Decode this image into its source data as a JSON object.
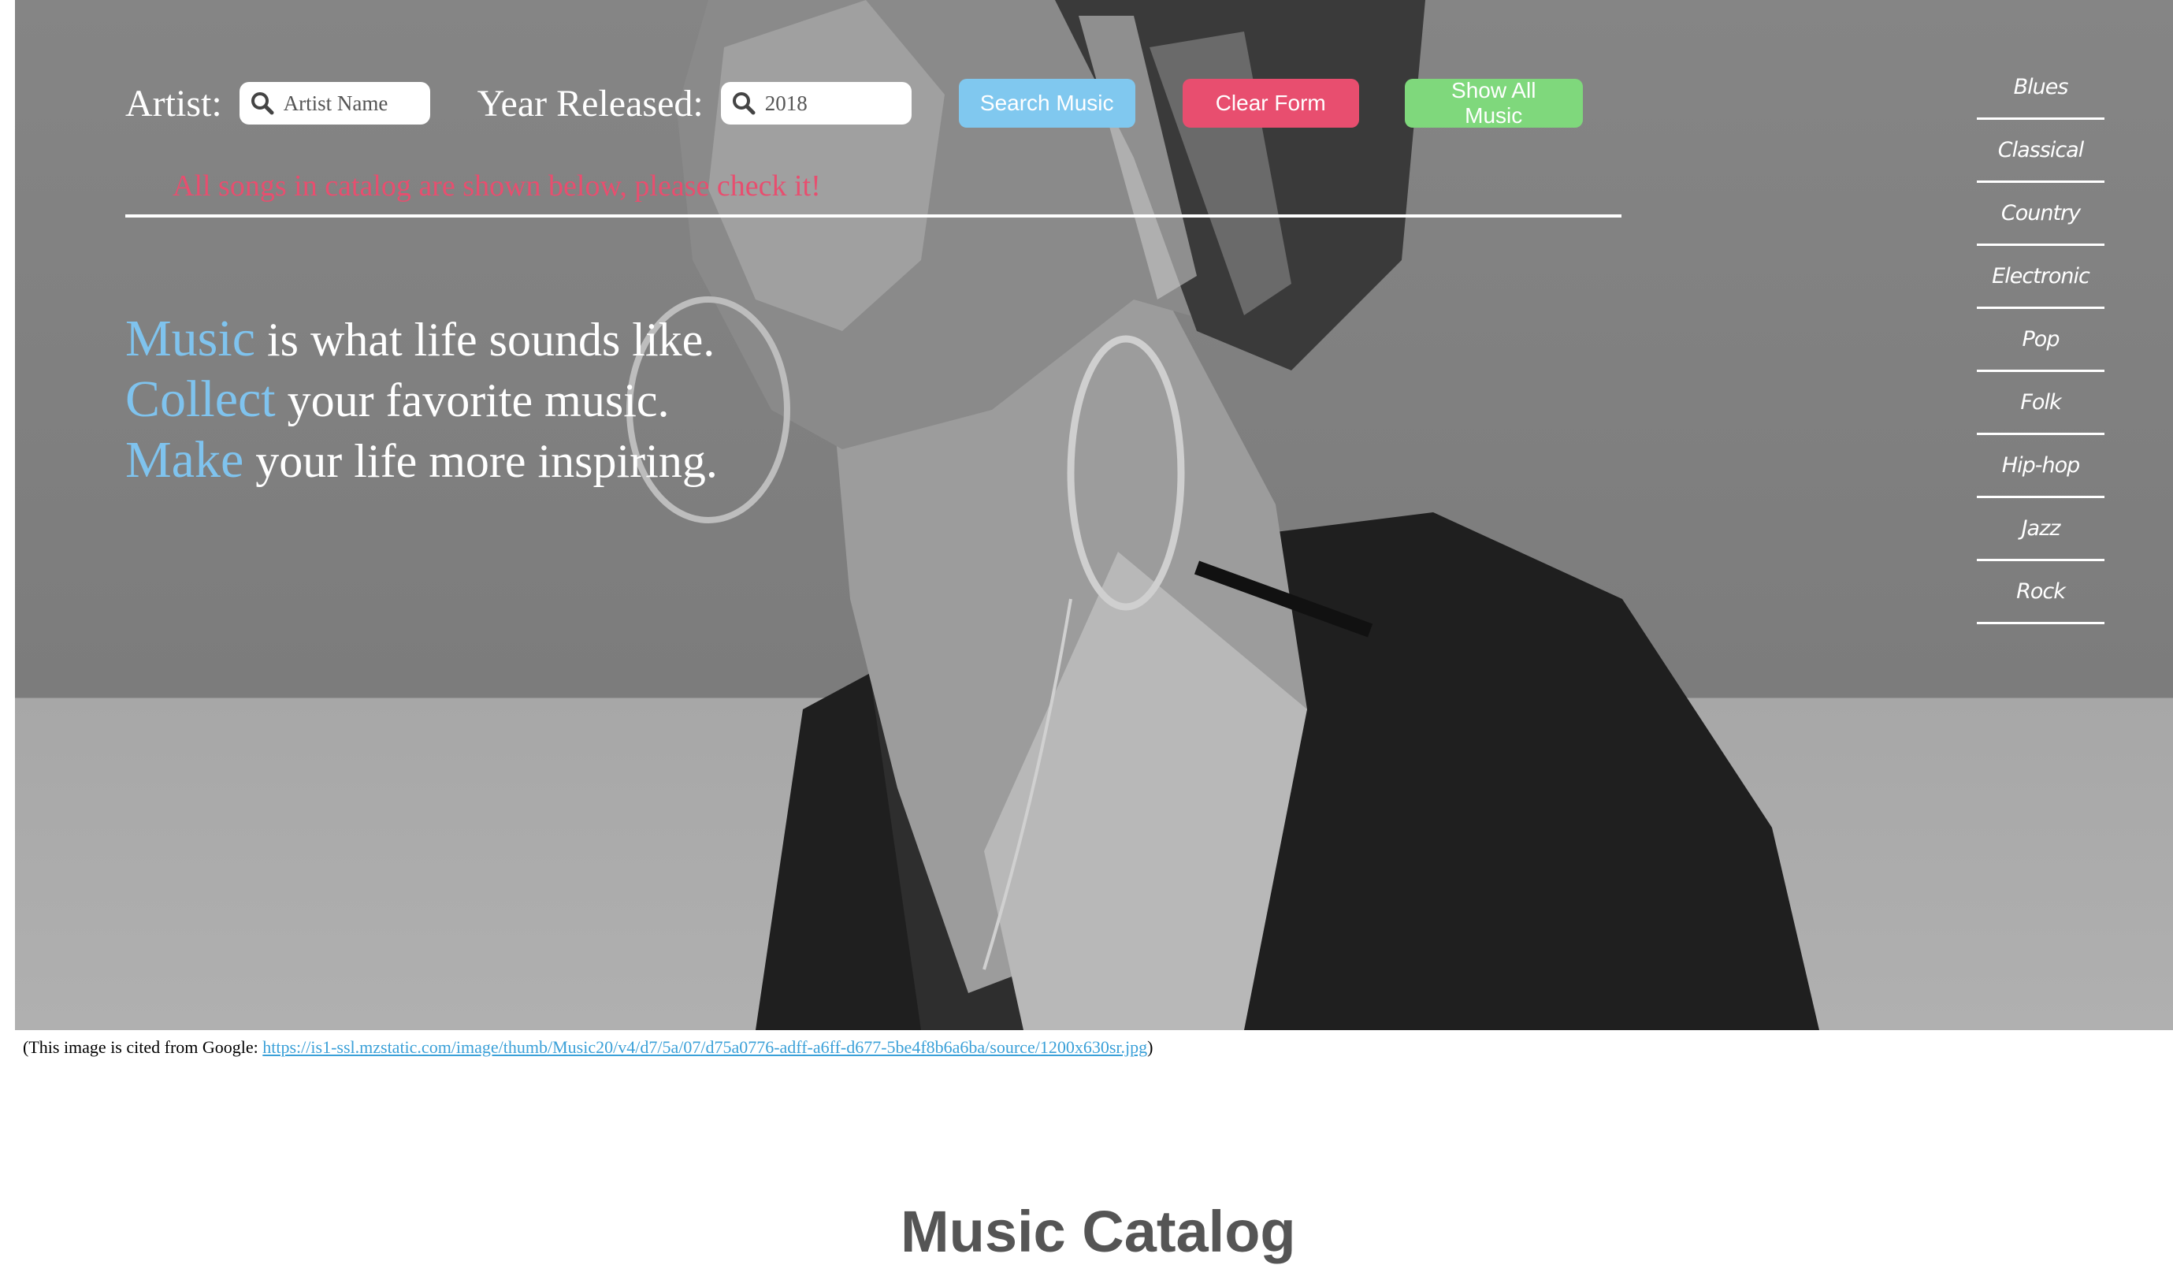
{
  "search": {
    "artist_label": "Artist:",
    "artist_placeholder": "Artist Name",
    "artist_value": "",
    "year_label": "Year Released:",
    "year_placeholder": "",
    "year_value": "2018",
    "search_button": "Search Music",
    "clear_button": "Clear Form",
    "show_all_button": "Show All Music"
  },
  "status_message": "All songs in catalog are shown below, please check it!",
  "slogan": [
    {
      "key": "Music",
      "rest": " is what life sounds like."
    },
    {
      "key": "Collect",
      "rest": " your favorite music."
    },
    {
      "key": "Make",
      "rest": " your life more inspiring."
    }
  ],
  "genres": [
    "Blues",
    "Classical",
    "Country",
    "Electronic",
    "Pop",
    "Folk",
    "Hip-hop",
    "Jazz",
    "Rock"
  ],
  "citation": {
    "prefix": "(This image is cited from Google: ",
    "link": "https://is1-ssl.mzstatic.com/image/thumb/Music20/v4/d7/5a/07/d75a0776-adff-a6ff-d677-5be4f8b6a6ba/source/1200x630sr.jpg",
    "suffix": ")"
  },
  "catalog_title": "Music Catalog",
  "colors": {
    "search_button": "#80c8ef",
    "clear_button": "#e84e6f",
    "show_all_button": "#7fd87c",
    "slogan_accent": "#7fc3ee",
    "status_text": "#e84e6f"
  }
}
